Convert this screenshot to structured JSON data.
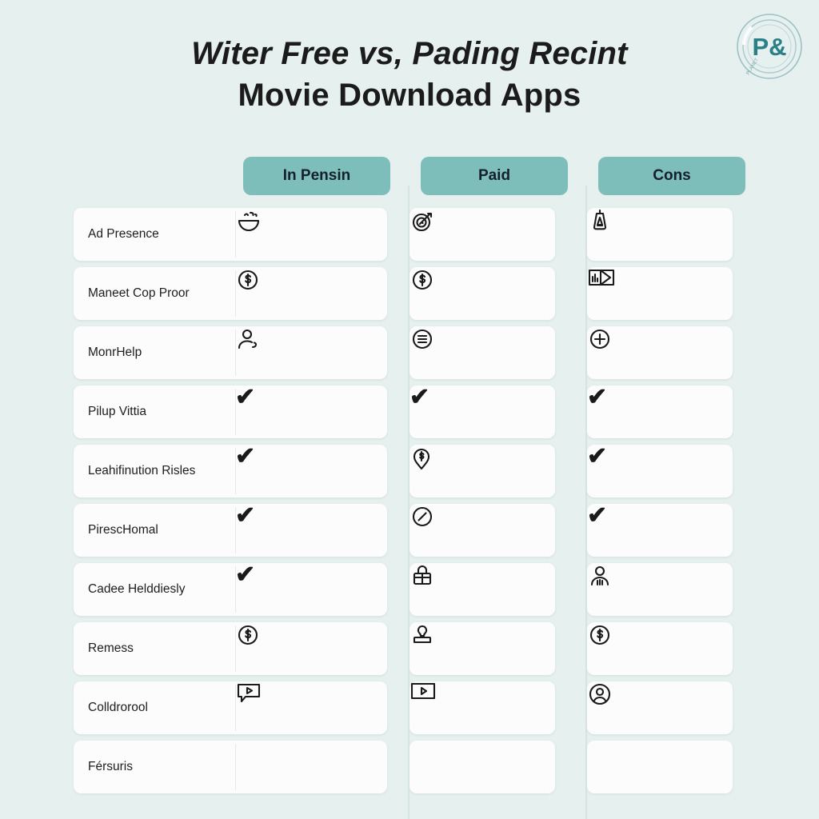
{
  "logo": {
    "text": "P&",
    "color": "#2b7f87",
    "ring_color": "#6aa8b0"
  },
  "title": {
    "line1": "Witer Free vs, Pading Recint",
    "line2": "Movie Download Apps"
  },
  "theme": {
    "background": "#e6f1ef",
    "header_pill": "#7dbdba",
    "card": "#fcfcfc",
    "text": "#1d1d1d"
  },
  "table": {
    "columns": [
      {
        "label": "In Pensin"
      },
      {
        "label": "Paid"
      },
      {
        "label": "Cons"
      }
    ],
    "rows": [
      {
        "label": "Ad Presence",
        "cells": [
          "smiley-bowl-icon",
          "target-dart-icon",
          "tag-label-icon"
        ]
      },
      {
        "label": "Maneet Cop Proor",
        "cells": [
          "dollar-circle-icon",
          "dollar-circle-icon",
          "chart-arrow-icon"
        ]
      },
      {
        "label": "MonrHelp",
        "cells": [
          "person-edit-icon",
          "menu-circle-icon",
          "plus-circle-icon"
        ]
      },
      {
        "label": "Pilup Vittia",
        "cells": [
          "check-icon",
          "check-icon",
          "check-icon"
        ]
      },
      {
        "label": "Leahifinution Risles",
        "cells": [
          "check-icon",
          "price-pin-icon",
          "check-icon"
        ]
      },
      {
        "label": "PirescHomal",
        "cells": [
          "check-icon",
          "slash-circle-icon",
          "check-icon"
        ]
      },
      {
        "label": "Cadee Helddiesly",
        "cells": [
          "check-icon",
          "lock-bag-icon",
          "person-icon"
        ]
      },
      {
        "label": "Remess",
        "cells": [
          "dollar-circle-icon",
          "stamp-icon",
          "dollar-circle-icon"
        ]
      },
      {
        "label": "Colldrorool",
        "cells": [
          "video-comment-icon",
          "video-play-icon",
          "person-circle-icon"
        ]
      },
      {
        "label": "Férsuris",
        "cells": [
          "dot-icon",
          "dot-icon",
          "dot-icon"
        ]
      }
    ]
  }
}
